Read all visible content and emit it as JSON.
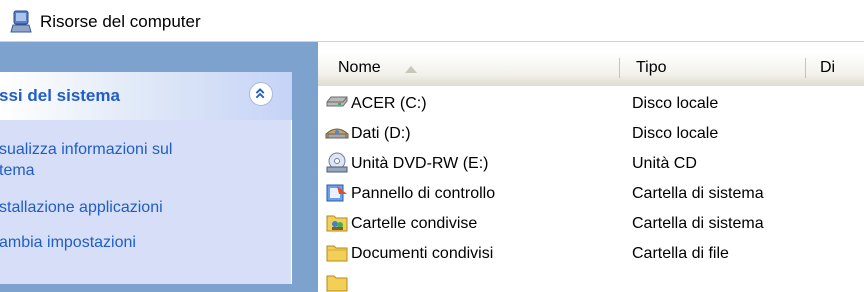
{
  "address_bar": {
    "title": "Risorse del computer",
    "icon": "computer-icon"
  },
  "task_pane": {
    "section_title": "ssi del sistema",
    "collapse_icon": "chevron-up-icon",
    "links": [
      {
        "line1": "sualizza informazioni sul",
        "line2": "tema"
      },
      {
        "line1": "stallazione applicazioni"
      },
      {
        "line1": "ambia impostazioni"
      }
    ]
  },
  "file_list": {
    "columns": {
      "name": "Nome",
      "type": "Tipo",
      "third": "Di"
    },
    "sort_indicator": "sort-ascending-icon",
    "rows": [
      {
        "name": "ACER (C:)",
        "type": "Disco locale",
        "icon": "hard-drive-icon"
      },
      {
        "name": "Dati (D:)",
        "type": "Disco locale",
        "icon": "hard-drive-icon"
      },
      {
        "name": "Unità DVD-RW (E:)",
        "type": "Unità CD",
        "icon": "dvd-drive-icon"
      },
      {
        "name": "Pannello di controllo",
        "type": "Cartella di sistema",
        "icon": "control-panel-icon"
      },
      {
        "name": "Cartelle condivise",
        "type": "Cartella di sistema",
        "icon": "shared-folders-icon"
      },
      {
        "name": "Documenti condivisi",
        "type": "Cartella di file",
        "icon": "folder-icon"
      }
    ]
  },
  "colors": {
    "task_pane_bg": "#7da2ce",
    "task_link": "#215dc6",
    "task_body": "#d6dff7"
  }
}
